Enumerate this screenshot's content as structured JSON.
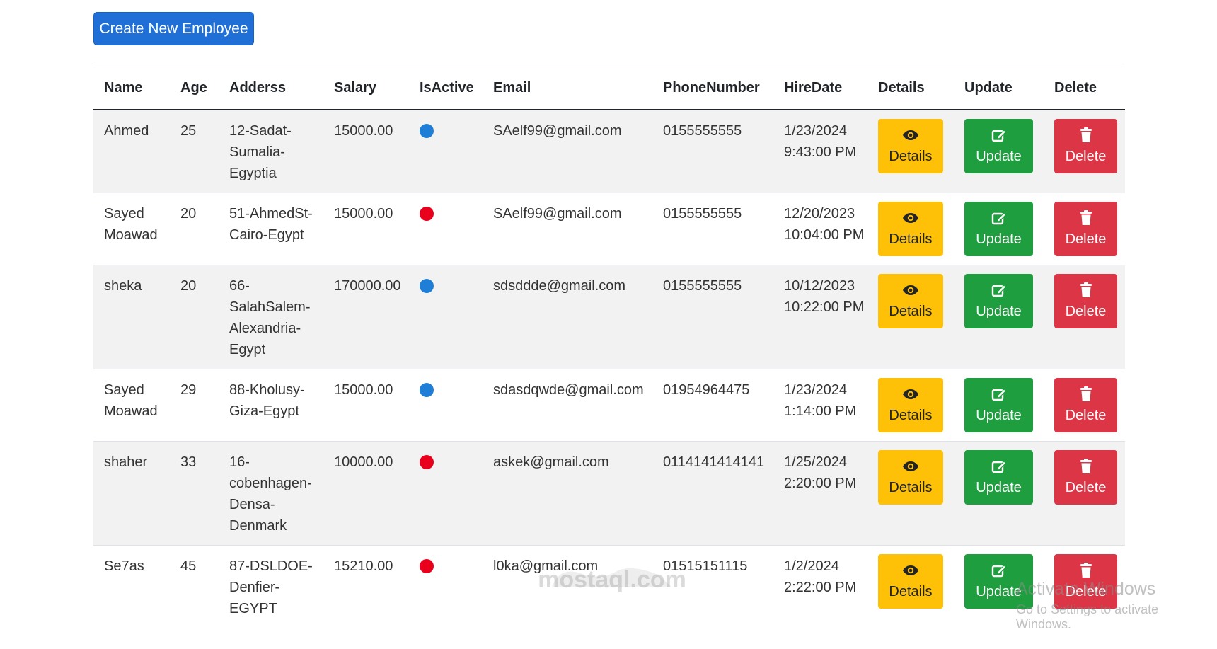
{
  "toolbar": {
    "create_label": "Create New Employee"
  },
  "table": {
    "headers": [
      "Name",
      "Age",
      "Adderss",
      "Salary",
      "IsActive",
      "Email",
      "PhoneNumber",
      "HireDate",
      "Details",
      "Update",
      "Delete"
    ],
    "rows": [
      {
        "name": "Ahmed",
        "age": "25",
        "address": "12-Sadat-Sumalia-Egyptia",
        "salary": "15000.00",
        "active": true,
        "email": "SAelf99@gmail.com",
        "phone": "0155555555",
        "hire_date": "1/23/2024 9:43:00 PM"
      },
      {
        "name": "Sayed Moawad",
        "age": "20",
        "address": "51-AhmedSt-Cairo-Egypt",
        "salary": "15000.00",
        "active": false,
        "email": "SAelf99@gmail.com",
        "phone": "0155555555",
        "hire_date": "12/20/2023 10:04:00 PM"
      },
      {
        "name": "sheka",
        "age": "20",
        "address": "66-SalahSalem-Alexandria-Egypt",
        "salary": "170000.00",
        "active": true,
        "email": "sdsddde@gmail.com",
        "phone": "0155555555",
        "hire_date": "10/12/2023 10:22:00 PM"
      },
      {
        "name": "Sayed Moawad",
        "age": "29",
        "address": "88-Kholusy-Giza-Egypt",
        "salary": "15000.00",
        "active": true,
        "email": "sdasdqwde@gmail.com",
        "phone": "01954964475",
        "hire_date": "1/23/2024 1:14:00 PM"
      },
      {
        "name": "shaher",
        "age": "33",
        "address": "16-cobenhagen-Densa-Denmark",
        "salary": "10000.00",
        "active": false,
        "email": "askek@gmail.com",
        "phone": "0114141414141",
        "hire_date": "1/25/2024 2:20:00 PM"
      },
      {
        "name": "Se7as",
        "age": "45",
        "address": "87-DSLDOE-Denfier-EGYPT",
        "salary": "15210.00",
        "active": false,
        "email": "l0ka@gmail.com",
        "phone": "01515151115",
        "hire_date": "1/2/2024 2:22:00 PM"
      }
    ]
  },
  "buttons": {
    "details_label": "Details",
    "update_label": "Update",
    "delete_label": "Delete"
  },
  "icons": {
    "details": "eye-icon",
    "update": "edit-icon",
    "delete": "trash-icon"
  },
  "colors": {
    "active": "#1f7fd6",
    "inactive": "#e8001c",
    "primary": "#1f6fd6",
    "warning": "#ffc107",
    "success": "#1e9e3e",
    "danger": "#dc3545"
  },
  "watermark": {
    "text": "mostaql.com"
  },
  "os_notice": {
    "title": "Activate Windows",
    "subtitle": "Go to Settings to activate Windows."
  }
}
